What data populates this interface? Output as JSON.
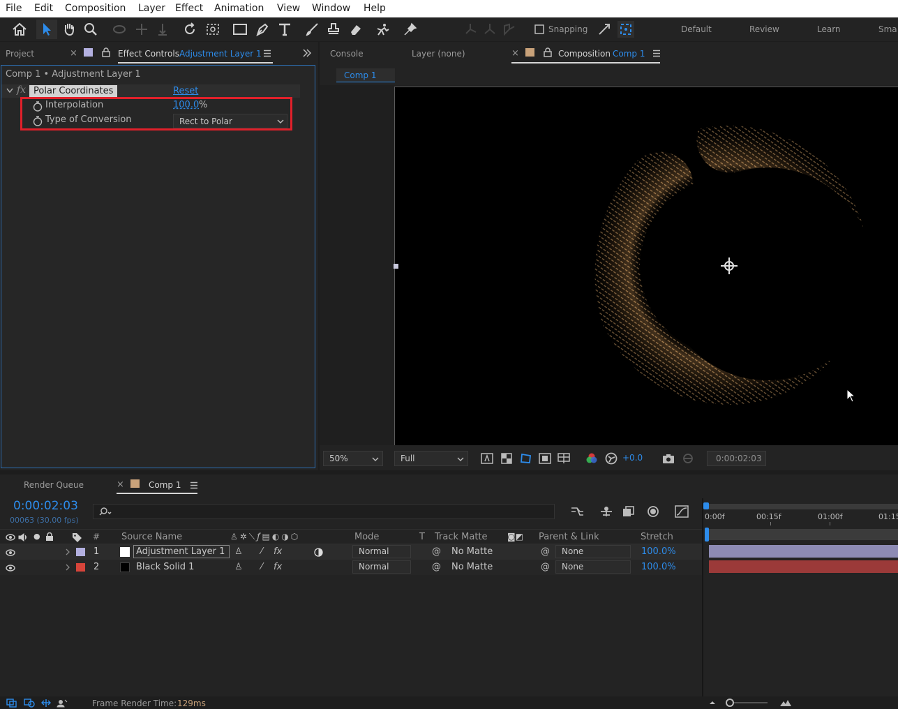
{
  "menu": [
    "File",
    "Edit",
    "Composition",
    "Layer",
    "Effect",
    "Animation",
    "View",
    "Window",
    "Help"
  ],
  "toolbar": {
    "snapping_label": "Snapping",
    "workspaces": [
      "Default",
      "Review",
      "Learn",
      "Sma"
    ]
  },
  "left_panel": {
    "tab_project": "Project",
    "tab_effect_controls": "Effect Controls",
    "tab_effect_controls_layer": "Adjustment Layer 1",
    "breadcrumb": "Comp 1 • Adjustment Layer 1",
    "effect": {
      "name": "Polar Coordinates",
      "reset_label": "Reset",
      "fx_label": "fx",
      "properties": [
        {
          "label": "Interpolation",
          "value_num": "100.0",
          "value_unit": "%"
        },
        {
          "label": "Type of Conversion",
          "value": "Rect to Polar"
        }
      ]
    }
  },
  "right_panel": {
    "tab_console": "Console",
    "tab_layer": "Layer (none)",
    "tab_composition": "Composition",
    "tab_composition_name": "Comp 1",
    "subtab": "Comp 1"
  },
  "viewer_bar": {
    "zoom": "50%",
    "resolution": "Full",
    "exposure": "+0.0",
    "timecode": "0:00:02:03"
  },
  "timeline": {
    "tab_render_queue": "Render Queue",
    "tab_comp": "Comp 1",
    "current_time": "0:00:02:03",
    "frame_info": "00063 (30.00 fps)",
    "search_icon_label": "⌕",
    "headers": {
      "num": "#",
      "source_name": "Source Name",
      "mode": "Mode",
      "t": "T",
      "track_matte": "Track Matte",
      "parent_link": "Parent & Link",
      "stretch": "Stretch"
    },
    "ruler": [
      "0:00f",
      "00:15f",
      "01:00f",
      "01:15"
    ],
    "layers": [
      {
        "num": "1",
        "name": "Adjustment Layer 1",
        "mode": "Normal",
        "matte": "No Matte",
        "parent": "None",
        "stretch": "100.0%",
        "label_color": "#b3b0e0",
        "swatch": "#ffffff",
        "bar_color": "#8d8bb4"
      },
      {
        "num": "2",
        "name": "Black Solid 1",
        "mode": "Normal",
        "matte": "No Matte",
        "parent": "None",
        "stretch": "100.0%",
        "label_color": "#d6443a",
        "swatch": "#000000",
        "bar_color": "#9b3a39"
      }
    ]
  },
  "status": {
    "frame_render_label": "Frame Render Time:",
    "frame_render_value": "129ms"
  },
  "colors": {
    "accent_blue": "#2d8ceb",
    "highlight_box": "#e0202a"
  }
}
